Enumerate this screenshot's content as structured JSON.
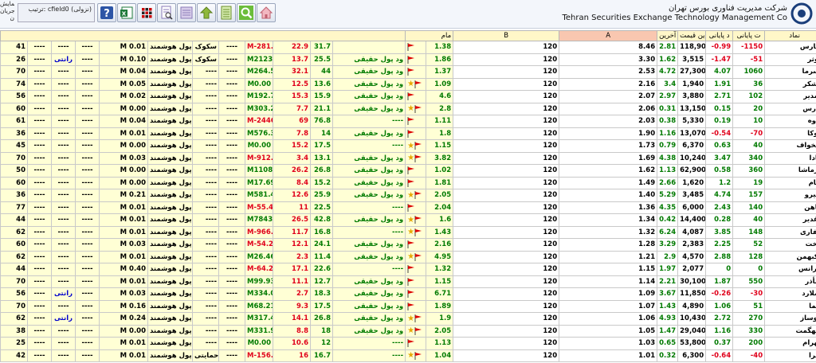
{
  "header": {
    "left_info_1": "نمایش",
    "left_info_2": "جریان ن",
    "sort_label": "ترتیب: cfield0 (نزولی)",
    "brand_fa": "شرکت مدیریت فناوری بورس تهران",
    "brand_en": "Tehran Securities Exchange Technology Management Co",
    "toolbar": [
      "help",
      "excel",
      "grid",
      "preview",
      "list",
      "up",
      "report",
      "search",
      "home"
    ]
  },
  "columns": {
    "c_name": "نماد",
    "c_v1": "ت پایانی",
    "c_v2": "د پایانی",
    "c_v3": "ین قیمت",
    "c_v4": "ید آخرین",
    "c_a": "A",
    "c_b": "B",
    "c_m": "مام"
  },
  "colors": {
    "red": "#e0001b",
    "green": "#007a00",
    "blue": "#0000cc",
    "yellow": "#ffffd5"
  },
  "rows": [
    {
      "name": "گپارس",
      "v1": "-1150",
      "v2": "-0.99",
      "v3": "118,900",
      "v4": "2.81",
      "a": "8.46",
      "b": "120",
      "m": "1.38",
      "star": false,
      "tag": "",
      "f1": "31.7",
      "f2": "22.9",
      "mval": "M-281.42",
      "t2": "----",
      "t3": "سکوک",
      "pool": "پول هوشمند",
      "mm": "M 0.01",
      "t4": "----",
      "t5": "----",
      "t6": "----",
      "n": "41"
    },
    {
      "name": "کوثر",
      "v1": "-51",
      "v2": "-1.47",
      "v3": "3,515",
      "v4": "1.62",
      "a": "3.30",
      "b": "120",
      "m": "1.86",
      "star": false,
      "tag": "ود پول حقیقی",
      "f1": "25.5",
      "f2": "13.7",
      "mval": "M2123.08",
      "t2": "----",
      "t3": "سکوک",
      "pool": "پول هوشمند",
      "mm": "M 0.10",
      "t4": "----",
      "t5": "رانتی",
      "t6": "----",
      "n": "26"
    },
    {
      "name": "لسرما",
      "v1": "1060",
      "v2": "4.07",
      "v3": "27,300",
      "v4": "4.72",
      "a": "2.53",
      "b": "120",
      "m": "1.37",
      "star": false,
      "tag": "ود پول حقیقی",
      "f1": "44",
      "f2": "32.1",
      "mval": "M264.52",
      "t2": "----",
      "t3": "----",
      "pool": "پول هوشمند",
      "mm": "M 0.04",
      "t4": "----",
      "t5": "----",
      "t6": "----",
      "n": "70"
    },
    {
      "name": "قشکر",
      "v1": "36",
      "v2": "1.91",
      "v3": "1,940",
      "v4": "3.4",
      "a": "2.16",
      "b": "120",
      "m": "1.09",
      "star": true,
      "tag": "ود پول حقیقی",
      "f1": "13.6",
      "f2": "12.5",
      "mval": "M0.00",
      "t2": "----",
      "t3": "----",
      "pool": "پول هوشمند",
      "mm": "M 0.05",
      "t4": "----",
      "t5": "----",
      "t6": "----",
      "n": "74"
    },
    {
      "name": "ومدیر",
      "v1": "102",
      "v2": "2.71",
      "v3": "3,880",
      "v4": "2.97",
      "a": "2.07",
      "b": "120",
      "m": "4.6",
      "star": false,
      "tag": "ود پول حقیقی",
      "f1": "15.9",
      "f2": "15.3",
      "mval": "M192.79",
      "t2": "----",
      "t3": "----",
      "pool": "پول هوشمند",
      "mm": "M 0.02",
      "t4": "----",
      "t5": "----",
      "t6": "----",
      "n": "56"
    },
    {
      "name": "وارس",
      "v1": "20",
      "v2": "0.15",
      "v3": "13,150",
      "v4": "0.31",
      "a": "2.06",
      "b": "120",
      "m": "2.8",
      "star": true,
      "tag": "ود پول حقیقی",
      "f1": "21.1",
      "f2": "7.7",
      "mval": "M303.29",
      "t2": "----",
      "t3": "----",
      "pool": "پول هوشمند",
      "mm": "M 0.00",
      "t4": "----",
      "t5": "----",
      "t6": "----",
      "n": "60"
    },
    {
      "name": "کاوه",
      "v1": "10",
      "v2": "0.19",
      "v3": "5,330",
      "v4": "0.38",
      "a": "2.03",
      "b": "120",
      "m": "1.11",
      "star": false,
      "tag": "----",
      "f1": "76.8",
      "f2": "69",
      "mval": "M-2446.10",
      "t2": "----",
      "t3": "----",
      "pool": "پول هوشمند",
      "mm": "M 0.04",
      "t4": "----",
      "t5": "----",
      "t6": "----",
      "n": "61"
    },
    {
      "name": "فوکا",
      "v1": "-70",
      "v2": "-0.54",
      "v3": "13,070",
      "v4": "1.16",
      "a": "1.90",
      "b": "120",
      "m": "1.8",
      "star": false,
      "tag": "ود پول حقیقی",
      "f1": "14",
      "f2": "7.8",
      "mval": "M576.31",
      "t2": "----",
      "t3": "----",
      "pool": "پول هوشمند",
      "mm": "M 0.01",
      "t4": "----",
      "t5": "----",
      "t6": "----",
      "n": "36"
    },
    {
      "name": "سخواف",
      "v1": "40",
      "v2": "0.63",
      "v3": "6,370",
      "v4": "0.79",
      "a": "1.73",
      "b": "120",
      "m": "1.15",
      "star": true,
      "tag": "----",
      "f1": "17.5",
      "f2": "15.2",
      "mval": "M0.00",
      "t2": "----",
      "t3": "----",
      "pool": "پول هوشمند",
      "mm": "M 0.00",
      "t4": "----",
      "t5": "----",
      "t6": "----",
      "n": "45"
    },
    {
      "name": "آبادا",
      "v1": "340",
      "v2": "3.47",
      "v3": "10,240",
      "v4": "4.38",
      "a": "1.69",
      "b": "120",
      "m": "3.82",
      "star": true,
      "tag": "ود پول حقیقی",
      "f1": "13.1",
      "f2": "3.4",
      "mval": "M-912.58",
      "t2": "----",
      "t3": "----",
      "pool": "پول هوشمند",
      "mm": "M 0.03",
      "t4": "----",
      "t5": "----",
      "t6": "----",
      "n": "70"
    },
    {
      "name": "کرماشا",
      "v1": "360",
      "v2": "0.58",
      "v3": "62,900",
      "v4": "1.13",
      "a": "1.62",
      "b": "120",
      "m": "1.02",
      "star": false,
      "tag": "ود پول حقیقی",
      "f1": "26.8",
      "f2": "26.2",
      "mval": "M1108.89",
      "t2": "----",
      "t3": "----",
      "pool": "پول هوشمند",
      "mm": "M 0.00",
      "t4": "----",
      "t5": "----",
      "t6": "----",
      "n": "50"
    },
    {
      "name": "بکام",
      "v1": "19",
      "v2": "1.2",
      "v3": "1,620",
      "v4": "2.66",
      "a": "1.49",
      "b": "120",
      "m": "1.81",
      "star": false,
      "tag": "ود پول حقیقی",
      "f1": "15.2",
      "f2": "8.4",
      "mval": "M17.69",
      "t2": "----",
      "t3": "----",
      "pool": "پول هوشمند",
      "mm": "M 0.00",
      "t4": "----",
      "t5": "----",
      "t6": "----",
      "n": "60"
    },
    {
      "name": "سیرو",
      "v1": "157",
      "v2": "4.74",
      "v3": "3,485",
      "v4": "5.29",
      "a": "1.40",
      "b": "120",
      "m": "2.05",
      "star": true,
      "tag": "ود پول حقیقی",
      "f1": "25.9",
      "f2": "12.6",
      "mval": "M581.41",
      "t2": "----",
      "t3": "----",
      "pool": "پول هوشمند",
      "mm": "M 0.21",
      "t4": "----",
      "t5": "----",
      "t6": "----",
      "n": "36"
    },
    {
      "name": "خاهن",
      "v1": "140",
      "v2": "2.43",
      "v3": "6,000",
      "v4": "4.35",
      "a": "1.36",
      "b": "120",
      "m": "2.04",
      "star": false,
      "tag": "----",
      "f1": "22.5",
      "f2": "11",
      "mval": "M-55.41",
      "t2": "----",
      "t3": "----",
      "pool": "پول هوشمند",
      "mm": "M 0.01",
      "t4": "----",
      "t5": "----",
      "t6": "----",
      "n": "77"
    },
    {
      "name": "وغدیر",
      "v1": "40",
      "v2": "0.28",
      "v3": "14,400",
      "v4": "0.42",
      "a": "1.34",
      "b": "120",
      "m": "1.6",
      "star": true,
      "tag": "ود پول حقیقی",
      "f1": "42.8",
      "f2": "26.5",
      "mval": "M7843.35",
      "t2": "----",
      "t3": "----",
      "pool": "پول هوشمند",
      "mm": "M 0.01",
      "t4": "----",
      "t5": "----",
      "t6": "----",
      "n": "44"
    },
    {
      "name": "حفاری",
      "v1": "148",
      "v2": "3.85",
      "v3": "4,087",
      "v4": "6.24",
      "a": "1.32",
      "b": "120",
      "m": "1.43",
      "star": true,
      "tag": "----",
      "f1": "16.8",
      "f2": "11.7",
      "mval": "M-966.99",
      "t2": "----",
      "t3": "----",
      "pool": "پول هوشمند",
      "mm": "M 0.01",
      "t4": "----",
      "t5": "----",
      "t6": "----",
      "n": "62"
    },
    {
      "name": "تاخت",
      "v1": "52",
      "v2": "2.25",
      "v3": "2,383",
      "v4": "3.29",
      "a": "1.28",
      "b": "120",
      "m": "2.16",
      "star": false,
      "tag": "ود پول حقیقی",
      "f1": "24.1",
      "f2": "12.1",
      "mval": "M-54.21",
      "t2": "----",
      "t3": "----",
      "pool": "پول هوشمند",
      "mm": "M 0.03",
      "t4": "----",
      "t5": "----",
      "t6": "----",
      "n": "60"
    },
    {
      "name": "وکبهمن",
      "v1": "128",
      "v2": "2.88",
      "v3": "4,570",
      "v4": "2.9",
      "a": "1.21",
      "b": "120",
      "m": "4.95",
      "star": true,
      "tag": "ود پول حقیقی",
      "f1": "11.4",
      "f2": "2.3",
      "mval": "M26.46",
      "t2": "----",
      "t3": "----",
      "pool": "پول هوشمند",
      "mm": "M 0.01",
      "t4": "----",
      "t5": "----",
      "t6": "----",
      "n": "62"
    },
    {
      "name": "بترانس",
      "v1": "0",
      "v2": "0",
      "v3": "2,077",
      "v4": "1.97",
      "a": "1.15",
      "b": "120",
      "m": "1.32",
      "star": false,
      "tag": "----",
      "f1": "22.6",
      "f2": "17.1",
      "mval": "M-64.21",
      "t2": "----",
      "t3": "----",
      "pool": "پول هوشمند",
      "mm": "M 0.40",
      "t4": "----",
      "t5": "----",
      "t6": "----",
      "n": "44"
    },
    {
      "name": "غبأذر",
      "v1": "550",
      "v2": "1.87",
      "v3": "30,100",
      "v4": "2.21",
      "a": "1.14",
      "b": "120",
      "m": "1.15",
      "star": false,
      "tag": "ود پول حقیقی",
      "f1": "12.7",
      "f2": "11.1",
      "mval": "M99.93",
      "t2": "----",
      "t3": "----",
      "pool": "پول هوشمند",
      "mm": "M 0.01",
      "t4": "----",
      "t5": "----",
      "t6": "----",
      "n": "70"
    },
    {
      "name": "زملارد",
      "v1": "-30",
      "v2": "-0.26",
      "v3": "11,850",
      "v4": "3.67",
      "a": "1.09",
      "b": "120",
      "m": "6.71",
      "star": false,
      "tag": "ود پول حقیقی",
      "f1": "18.3",
      "f2": "2.7",
      "mval": "M334.03",
      "t2": "----",
      "t3": "----",
      "pool": "پول هوشمند",
      "mm": "M 0.03",
      "t4": "----",
      "t5": "رانتی",
      "t6": "----",
      "n": "56"
    },
    {
      "name": "تکما",
      "v1": "51",
      "v2": "1.06",
      "v3": "4,890",
      "v4": "1.43",
      "a": "1.07",
      "b": "120",
      "m": "1.89",
      "star": false,
      "tag": "ود پول حقیقی",
      "f1": "17.5",
      "f2": "9.3",
      "mval": "M68.21",
      "t2": "----",
      "t3": "----",
      "pool": "پول هوشمند",
      "mm": "M 0.16",
      "t4": "----",
      "t5": "----",
      "t6": "----",
      "n": "70"
    },
    {
      "name": "خوساز",
      "v1": "270",
      "v2": "2.72",
      "v3": "10,430",
      "v4": "4.93",
      "a": "1.06",
      "b": "120",
      "m": "1.9",
      "star": true,
      "tag": "ود پول حقیقی",
      "f1": "26.8",
      "f2": "14.1",
      "mval": "M317.40",
      "t2": "----",
      "t3": "----",
      "pool": "پول هوشمند",
      "mm": "M 0.24",
      "t4": "----",
      "t5": "رانتی",
      "t6": "----",
      "n": "62"
    },
    {
      "name": "سهگمت",
      "v1": "330",
      "v2": "1.16",
      "v3": "29,040",
      "v4": "1.47",
      "a": "1.05",
      "b": "120",
      "m": "2.05",
      "star": true,
      "tag": "ود پول حقیقی",
      "f1": "18",
      "f2": "8.8",
      "mval": "M331.98",
      "t2": "----",
      "t3": "----",
      "pool": "پول هوشمند",
      "mm": "M 0.00",
      "t4": "----",
      "t5": "----",
      "t6": "----",
      "n": "38"
    },
    {
      "name": "کهرام",
      "v1": "200",
      "v2": "0.37",
      "v3": "53,800",
      "v4": "0.65",
      "a": "1.03",
      "b": "120",
      "m": "1.13",
      "star": false,
      "tag": "----",
      "f1": "12",
      "f2": "10.6",
      "mval": "M0.00",
      "t2": "----",
      "t3": "----",
      "pool": "پول هوشمند",
      "mm": "M 0.01",
      "t4": "----",
      "t5": "----",
      "t6": "----",
      "n": "25"
    },
    {
      "name": "نمرا",
      "v1": "-40",
      "v2": "-0.64",
      "v3": "6,300",
      "v4": "0.32",
      "a": "1.01",
      "b": "120",
      "m": "1.04",
      "star": true,
      "tag": "----",
      "f1": "16.7",
      "f2": "16",
      "mval": "M-156.18",
      "t2": "----",
      "t3": "سطح حمایتی",
      "pool": "پول هوشمند",
      "mm": "M 0.01",
      "t4": "----",
      "t5": "----",
      "t6": "----",
      "n": "42"
    }
  ]
}
